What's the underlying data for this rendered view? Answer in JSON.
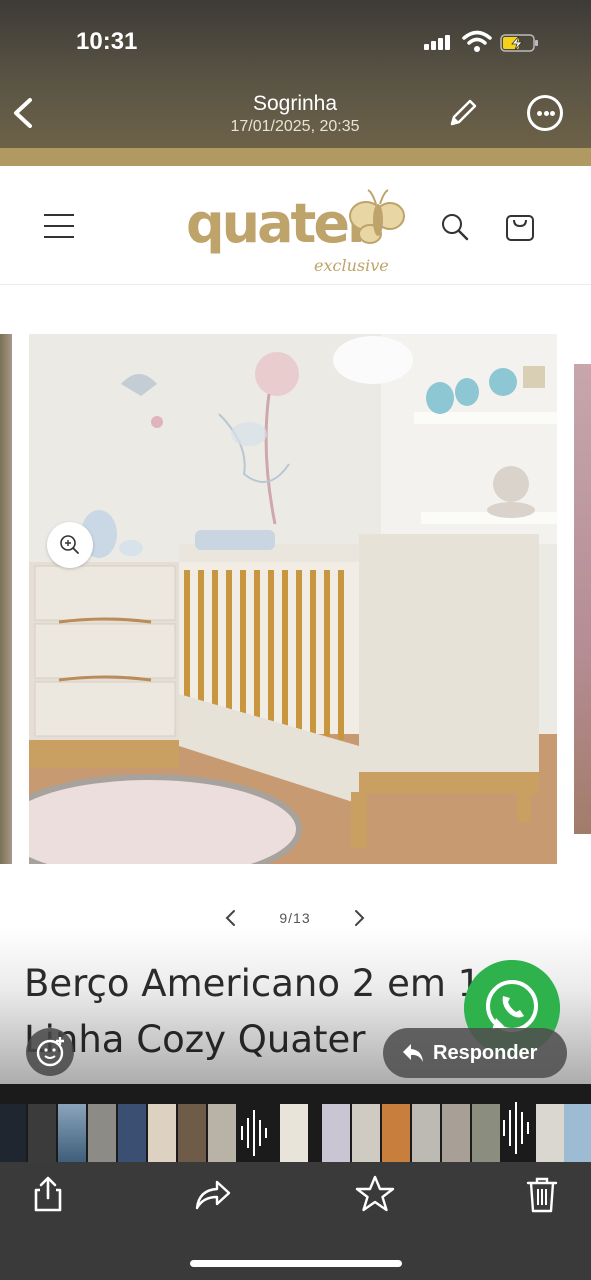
{
  "status_bar": {
    "time": "10:31"
  },
  "header": {
    "chat_name": "Sogrinha",
    "chat_date": "17/01/2025, 20:35"
  },
  "webpage": {
    "brand": {
      "name": "quater",
      "tagline": "exclusive"
    },
    "gallery": {
      "pager_text": "9/13"
    },
    "product_title_line1": "Berço Americano 2 em 1",
    "product_title_line2": "Linha Cozy Quater"
  },
  "overlay": {
    "reply_label": "Responder"
  },
  "icons": {
    "back": "chevron-left-icon",
    "edit": "pencil-icon",
    "more": "ellipsis-icon",
    "menu": "hamburger-icon",
    "search": "search-icon",
    "cart": "bag-icon",
    "zoom": "zoom-in-icon",
    "whatsapp": "whatsapp-icon",
    "sticker": "sticker-icon",
    "reply": "reply-icon",
    "share": "share-icon",
    "forward": "forward-icon",
    "star": "star-icon",
    "delete": "trash-icon"
  },
  "colors": {
    "header_bg": "#5a5445",
    "gold_accent": "#b09a62",
    "brand_gold": "#bea36a",
    "whatsapp_green": "#2fb24c",
    "toolbar_bg": "#3a3a3a"
  }
}
